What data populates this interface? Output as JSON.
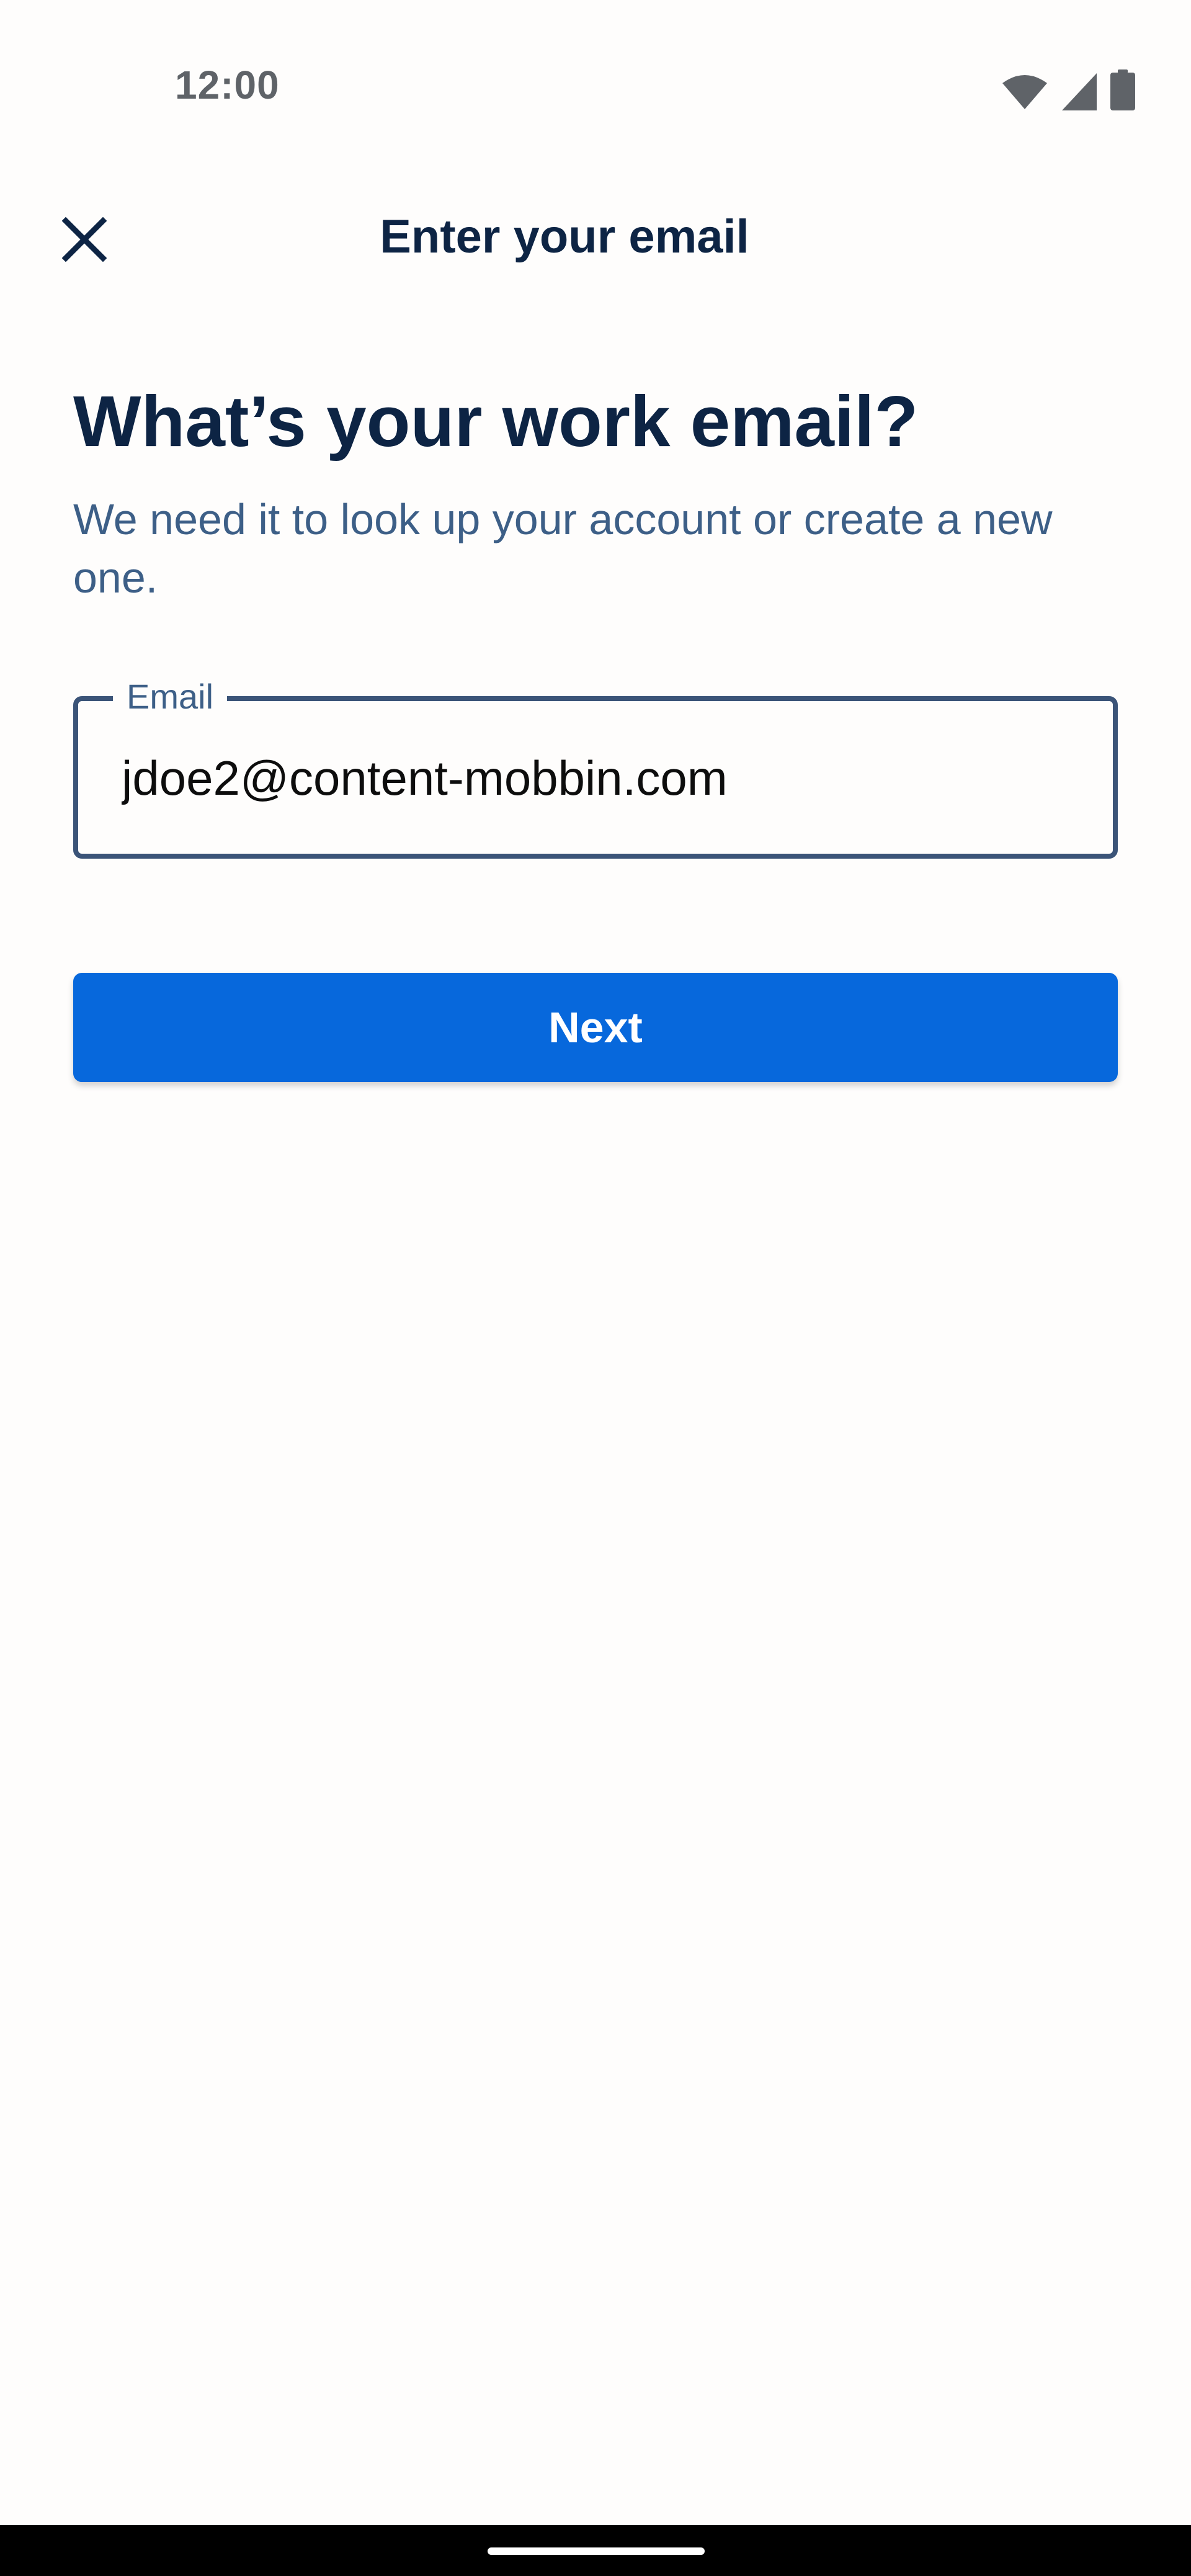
{
  "status_bar": {
    "time": "12:00",
    "icons": [
      "wifi-icon",
      "cellular-signal-icon",
      "battery-icon"
    ]
  },
  "app_bar": {
    "close_icon": "close-icon",
    "title": "Enter your email"
  },
  "main": {
    "heading": "What’s your work email?",
    "subheading": "We need it to look up your account or create a new one.",
    "email_field": {
      "label": "Email",
      "value": "jdoe2@content-mobbin.com"
    },
    "next_button": {
      "label": "Next"
    }
  },
  "colors": {
    "primary": "#0768dc",
    "text_dark": "#0d2444",
    "text_muted": "#3d5f87",
    "field_border": "#3b5478",
    "background": "#fefdfc"
  }
}
